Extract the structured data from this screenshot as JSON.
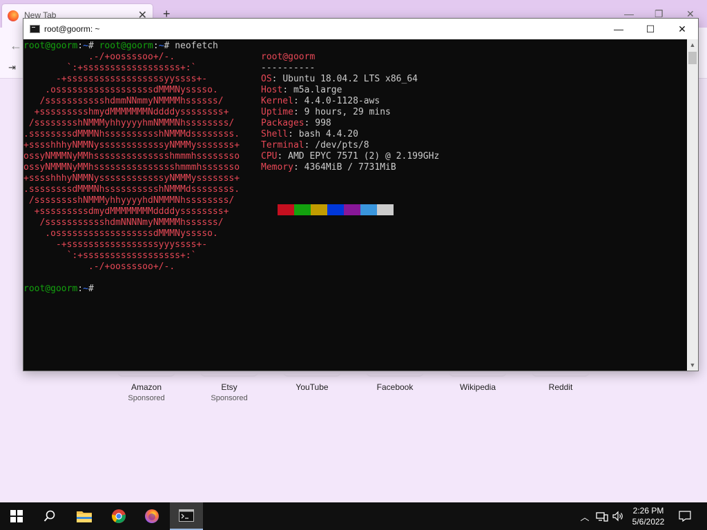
{
  "browser": {
    "tab_title": "New Tab",
    "tab_close": "✕",
    "new_tab": "+",
    "back_glyph": "←",
    "signin_glyph": "⇥",
    "shortcuts": [
      {
        "name": "Amazon",
        "sponsor": "Sponsored"
      },
      {
        "name": "Etsy",
        "sponsor": "Sponsored"
      },
      {
        "name": "YouTube",
        "sponsor": ""
      },
      {
        "name": "Facebook",
        "sponsor": ""
      },
      {
        "name": "Wikipedia",
        "sponsor": ""
      },
      {
        "name": "Reddit",
        "sponsor": ""
      }
    ]
  },
  "terminal": {
    "title": "root@goorm: ~",
    "minimize": "—",
    "maximize": "☐",
    "close": "✕",
    "prompt_user": "root@goorm",
    "prompt_sep": ":",
    "prompt_path": "~",
    "prompt_end": "# ",
    "command": "neofetch",
    "ascii": [
      "            .-/+oossssoo+/-.",
      "        `:+ssssssssssssssssss+:`",
      "      -+ssssssssssssssssssyyssss+-",
      "    .ossssssssssssssssssdMMMNysssso.",
      "   /ssssssssssshdmmNNmmyNMMMMhssssss/",
      "  +ssssssssshmydMMMMMMMNddddyssssssss+",
      " /sssssssshNMMMyhhyyyyhmNMMMNhssssssss/",
      ".ssssssssdMMMNhsssssssssshNMMMdssssssss.",
      "+sssshhhyNMMNyssssssssssssyNMMMysssssss+",
      "ossyNMMMNyMMhsssssssssssssshmmmhssssssso",
      "ossyNMMMNyMMhssssssssssssssshmmmhsssssso",
      "+sssshhhyNMMNyssssssssssssyNMMMysssssss+",
      ".ssssssssdMMMNhsssssssssshNMMMdssssssss.",
      " /sssssssshNMMMyhhyyyyhdNMMMNhssssssss/",
      "  +sssssssssdmydMMMMMMMMddddyssssssss+",
      "   /ssssssssssshdmNNNNmyNMMMMhssssss/",
      "    .ossssssssssssssssssdMMMNysssso.",
      "      -+sssssssssssssssssyyyssss+-",
      "        `:+ssssssssssssssssss+:`",
      "            .-/+oossssoo+/-."
    ],
    "header": "root@goorm",
    "separator": "----------",
    "info": [
      {
        "key": "OS",
        "value": "Ubuntu 18.04.2 LTS x86_64"
      },
      {
        "key": "Host",
        "value": "m5a.large"
      },
      {
        "key": "Kernel",
        "value": "4.4.0-1128-aws"
      },
      {
        "key": "Uptime",
        "value": "9 hours, 29 mins"
      },
      {
        "key": "Packages",
        "value": "998"
      },
      {
        "key": "Shell",
        "value": "bash 4.4.20"
      },
      {
        "key": "Terminal",
        "value": "/dev/pts/8"
      },
      {
        "key": "CPU",
        "value": "AMD EPYC 7571 (2) @ 2.199GHz"
      },
      {
        "key": "Memory",
        "value": "4364MiB / 7731MiB"
      }
    ],
    "key_sep": ": ",
    "color_swatches": [
      "#c50f1f",
      "#13a10e",
      "#c19c00",
      "#0037da",
      "#881798",
      "#3a96dd",
      "#cccccc"
    ]
  },
  "taskbar": {
    "time": "2:26 PM",
    "date": "5/6/2022",
    "tray_chevron": "︿"
  }
}
